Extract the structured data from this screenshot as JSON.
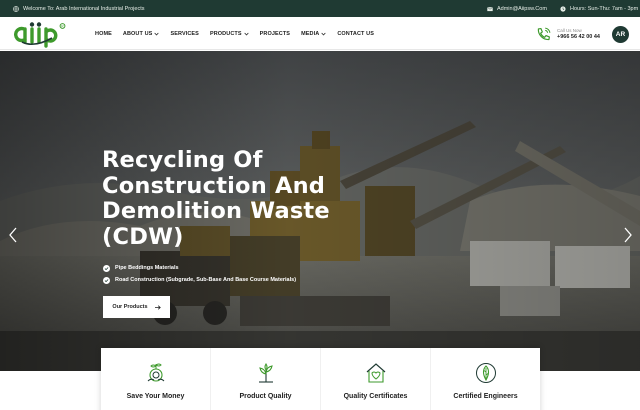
{
  "topbar": {
    "welcome": "Welcome To: Arab International Industrial Projects",
    "email": "Admin@Aiipsw.Com",
    "hours": "Hours: Sun-Thu: 7am - 3pm"
  },
  "logo": {
    "text": "aiip"
  },
  "nav": {
    "items": [
      {
        "label": "HOME",
        "has_caret": false
      },
      {
        "label": "ABOUT US",
        "has_caret": true
      },
      {
        "label": "SERVICES",
        "has_caret": false
      },
      {
        "label": "PRODUCTS",
        "has_caret": true
      },
      {
        "label": "PROJECTS",
        "has_caret": false
      },
      {
        "label": "MEDIA",
        "has_caret": true
      },
      {
        "label": "CONTACT US",
        "has_caret": false
      }
    ]
  },
  "call": {
    "label": "Call Us Now",
    "number": "+966 56 42 00 44"
  },
  "lang": "AR",
  "hero": {
    "title_lines": [
      "Recycling Of",
      "Construction And",
      "Demolition Waste",
      "(CDW)"
    ],
    "bullets": [
      "Pipe Beddings Materials",
      "Road Construction (Subgrade, Sub-Base And Base Course Materials)"
    ],
    "cta_label": "Our Products"
  },
  "features": [
    {
      "label": "Save Your Money",
      "icon": "money-plant-icon"
    },
    {
      "label": "Product Quality",
      "icon": "quality-plant-icon"
    },
    {
      "label": "Quality Certificates",
      "icon": "certificate-house-icon"
    },
    {
      "label": "Certified Engineers",
      "icon": "leaf-badge-icon"
    }
  ],
  "colors": {
    "brand_green": "#3e9a2c",
    "dark_teal": "#1f3a33",
    "text_dark": "#1e1e1e"
  }
}
